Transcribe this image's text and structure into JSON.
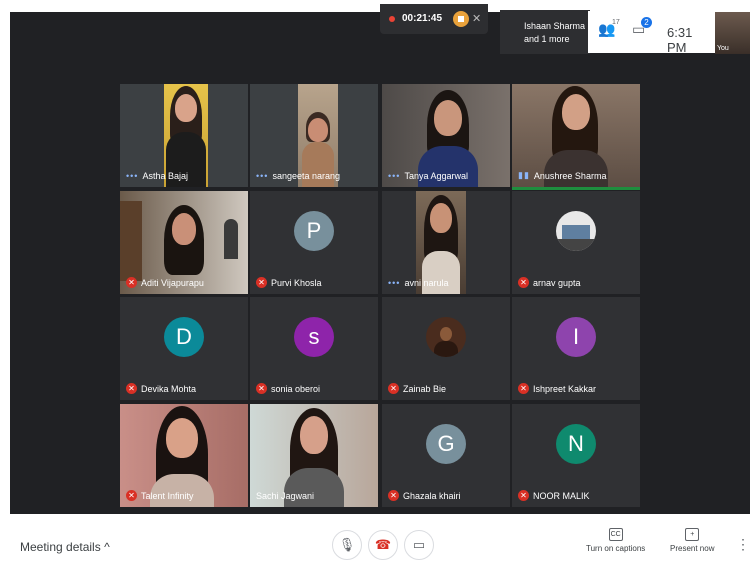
{
  "recording": {
    "time": "00:21:45"
  },
  "presenter": {
    "line1": "Ishaan Sharma",
    "line2": "and 1 more"
  },
  "tray": {
    "people_icon": "people-icon",
    "people_count": "17",
    "chat_icon": "chat-icon",
    "chat_badge": "2",
    "time": "6:31 PM",
    "self_label": "You"
  },
  "participants": [
    {
      "name": "Astha Bajaj",
      "status": "dots"
    },
    {
      "name": "sangeeta narang",
      "status": "dots"
    },
    {
      "name": "Tanya Aggarwal",
      "status": "dots"
    },
    {
      "name": "Anushree Sharma",
      "status": "speaking"
    },
    {
      "name": "Aditi Vijapurapu",
      "status": "muted"
    },
    {
      "name": "Purvi Khosla",
      "status": "muted",
      "initial": "P",
      "color": "#78909c"
    },
    {
      "name": "avni narula",
      "status": "dots"
    },
    {
      "name": "arnav gupta",
      "status": "muted"
    },
    {
      "name": "Devika Mohta",
      "status": "muted",
      "initial": "D",
      "color": "#0b8a99"
    },
    {
      "name": "sonia oberoi",
      "status": "muted",
      "initial": "s",
      "color": "#8e24aa"
    },
    {
      "name": "Zainab Bie",
      "status": "muted"
    },
    {
      "name": "Ishpreet Kakkar",
      "status": "muted",
      "initial": "I",
      "color": "#8e44ad"
    },
    {
      "name": "Talent Infinity",
      "status": "muted"
    },
    {
      "name": "Sachi Jagwani",
      "status": "none"
    },
    {
      "name": "Ghazala khairi",
      "status": "muted",
      "initial": "G",
      "color": "#78909c"
    },
    {
      "name": "NOOR MALIK",
      "status": "muted",
      "initial": "N",
      "color": "#0f8a6e"
    }
  ],
  "bottom_bar": {
    "meeting_details": "Meeting details",
    "captions_label": "Turn on captions",
    "captions_icon_text": "CC",
    "present_label": "Present now"
  }
}
